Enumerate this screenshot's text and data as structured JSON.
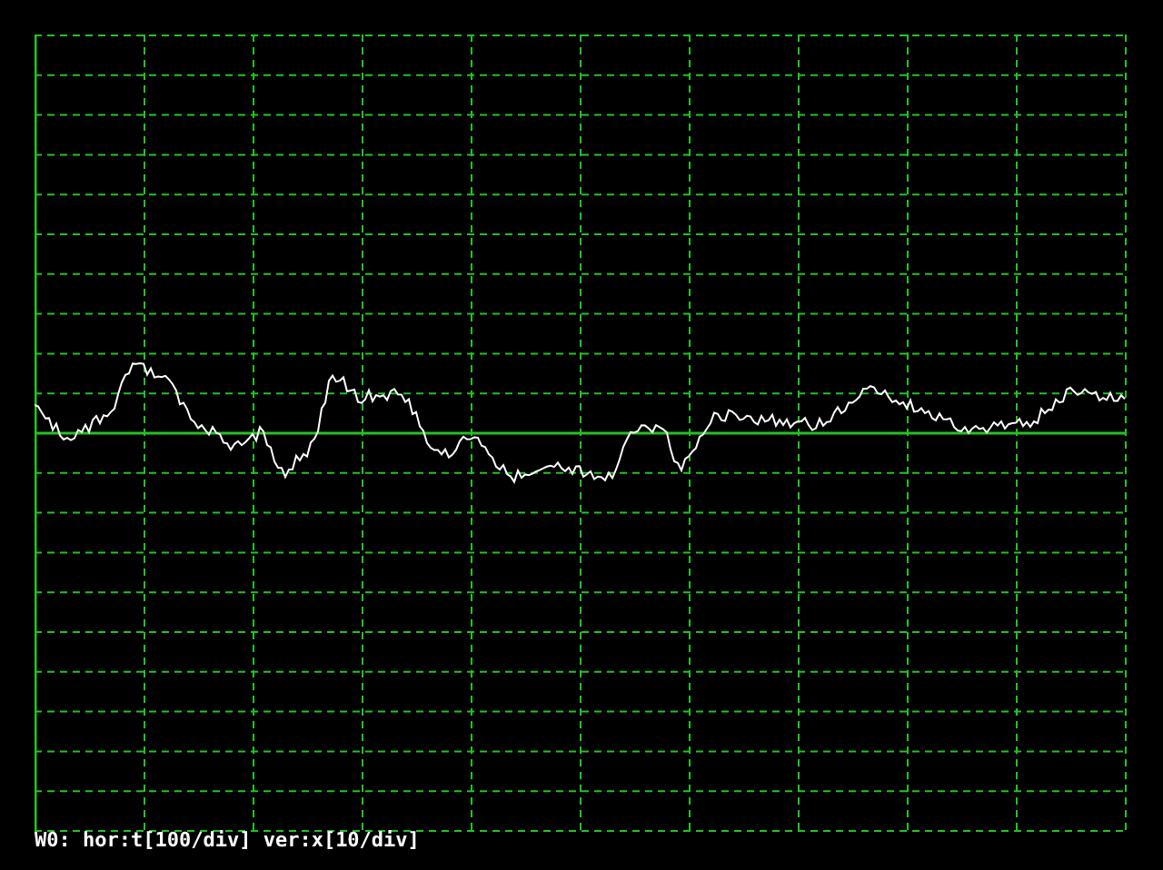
{
  "status_line": "W0: hor:t[100/div] ver:x[10/div]"
}
